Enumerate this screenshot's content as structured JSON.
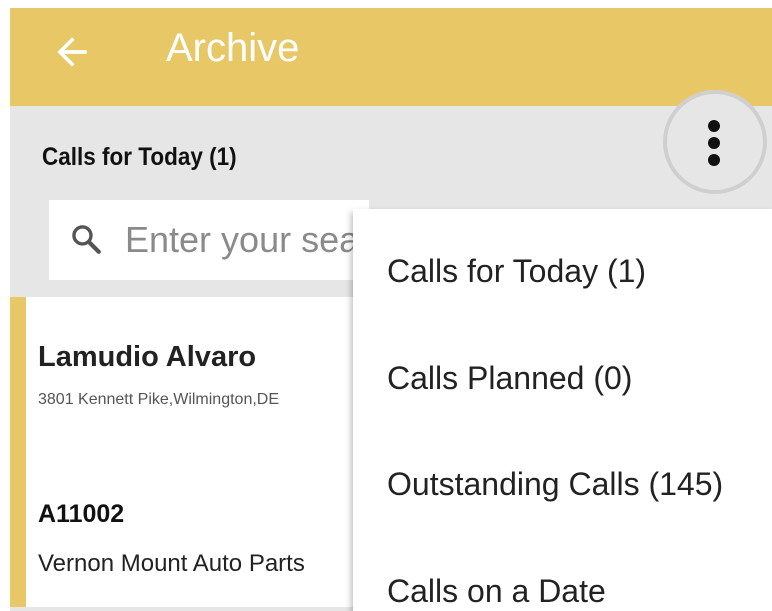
{
  "header": {
    "title": "Archive",
    "back_icon": "arrow-left-icon",
    "overflow_icon": "more-vertical-icon",
    "background_color": "#e8c767"
  },
  "subheader": {
    "label": "Calls for Today (1)"
  },
  "search": {
    "placeholder": "Enter your search",
    "value": "",
    "icon": "search-icon"
  },
  "list": {
    "items": [
      {
        "name": "Lamudio Alvaro",
        "address": "3801 Kennett Pike,Wilmington,DE",
        "code": "A11002",
        "company": "Vernon Mount Auto Parts",
        "accent_color": "#e8c767"
      }
    ]
  },
  "menu": {
    "items": [
      {
        "label": "Calls for Today (1)"
      },
      {
        "label": "Calls Planned (0)"
      },
      {
        "label": "Outstanding Calls (145)"
      },
      {
        "label": "Calls on a Date"
      }
    ]
  }
}
